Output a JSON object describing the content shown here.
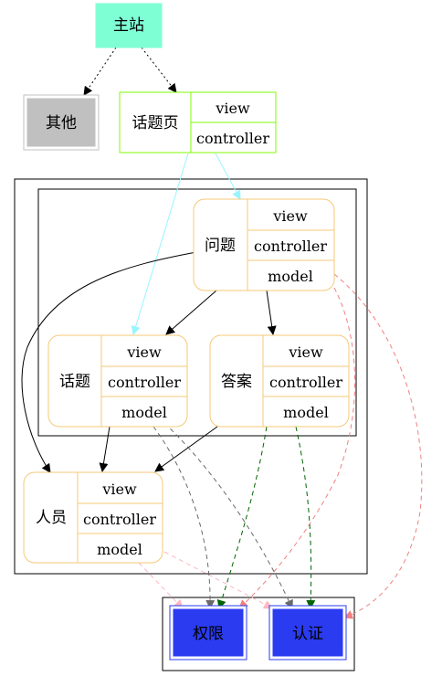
{
  "nodes": {
    "main_site": {
      "label": "主站",
      "fill": "#7fffd4"
    },
    "other": {
      "label": "其他",
      "fill": "#c0c0c0"
    },
    "topic_page": {
      "label": "话题页",
      "fields": [
        "view",
        "controller"
      ],
      "border": "#7cfc00"
    },
    "question": {
      "label": "问题",
      "fields": [
        "view",
        "controller",
        "model"
      ],
      "border": "#f5c97a"
    },
    "topic": {
      "label": "话题",
      "fields": [
        "view",
        "controller",
        "model"
      ],
      "border": "#f5c97a"
    },
    "answer": {
      "label": "答案",
      "fields": [
        "view",
        "controller",
        "model"
      ],
      "border": "#f5c97a"
    },
    "person": {
      "label": "人员",
      "fields": [
        "view",
        "controller",
        "model"
      ],
      "border": "#f5c97a"
    },
    "permission": {
      "label": "权限",
      "fill": "#2a3bf0"
    },
    "auth": {
      "label": "认证",
      "fill": "#2a3bf0"
    }
  },
  "edge_colors": {
    "dotted": "#000000",
    "cyan": "#98f5ff",
    "solid": "#000000",
    "salmon": "#f08080",
    "pink": "#ffb6c1",
    "gray": "#696969",
    "green": "#006400"
  }
}
